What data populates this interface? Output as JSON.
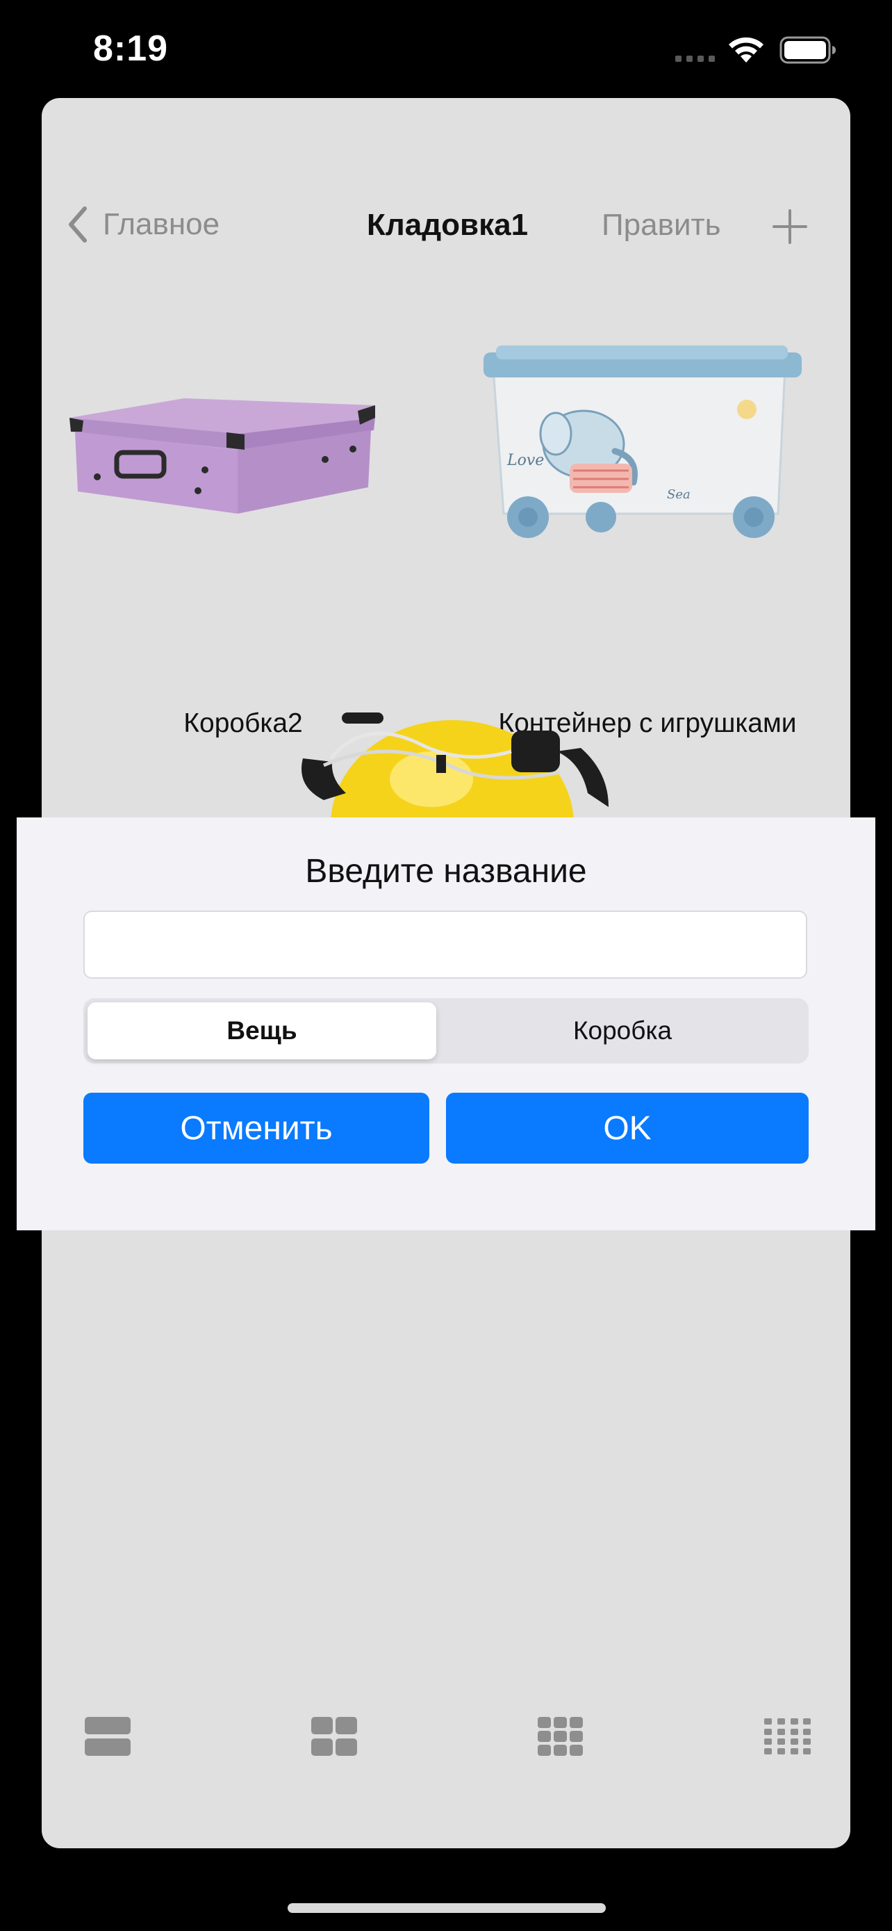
{
  "status_bar": {
    "time": "8:19"
  },
  "nav": {
    "back_label": "Главное",
    "title": "Кладовка1",
    "edit_label": "Править",
    "add_icon": "plus-icon"
  },
  "items": [
    {
      "caption": "Коробка2",
      "thumb": "purple-storage-box"
    },
    {
      "caption": "Контейнер с игрушками",
      "thumb": "toy-container-on-wheels"
    },
    {
      "caption": "",
      "thumb": "yellow-drinking-helmet"
    }
  ],
  "layout_bar": {
    "icons": [
      "one-column-icon",
      "two-column-icon",
      "three-column-icon",
      "four-column-icon"
    ]
  },
  "dialog": {
    "title": "Введите название",
    "name_value": "",
    "name_placeholder": "",
    "segments": [
      "Вещь",
      "Коробка"
    ],
    "selected_segment": "Вещь",
    "cancel_label": "Отменить",
    "ok_label": "OK"
  },
  "colors": {
    "accent": "#0a7aff",
    "sheet_background": "#e0e0e0",
    "dialog_background": "#f2f2f7",
    "nav_inactive": "#8c8c8c"
  }
}
